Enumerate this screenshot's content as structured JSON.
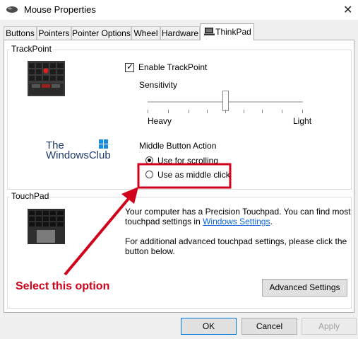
{
  "window": {
    "title": "Mouse Properties"
  },
  "tabs": [
    {
      "label": "Buttons"
    },
    {
      "label": "Pointers"
    },
    {
      "label": "Pointer Options"
    },
    {
      "label": "Wheel"
    },
    {
      "label": "Hardware"
    },
    {
      "label": "ThinkPad"
    }
  ],
  "trackpoint": {
    "group_label": "TrackPoint",
    "enable_label": "Enable TrackPoint",
    "enabled": true,
    "sensitivity_label": "Sensitivity",
    "sensitivity_level": 0.5,
    "heavy_label": "Heavy",
    "light_label": "Light",
    "middle_action_label": "Middle Button Action",
    "options": [
      {
        "label": "Use for scrolling",
        "selected": true
      },
      {
        "label": "Use as middle click",
        "selected": false
      }
    ]
  },
  "watermark": {
    "line1": "The",
    "line2": "WindowsClub"
  },
  "touchpad": {
    "group_label": "TouchPad",
    "info_line1": "Your computer has a Precision Touchpad. You can find most",
    "info_line2_prefix": "touchpad settings in ",
    "info_link": "Windows Settings",
    "info_line2_suffix": ".",
    "additional_line1": "For additional advanced touchpad settings, please click the",
    "additional_line2": "button below.",
    "advanced_button": "Advanced Settings"
  },
  "annotation": {
    "text": "Select this option"
  },
  "footer": {
    "ok": "OK",
    "cancel": "Cancel",
    "apply": "Apply"
  },
  "colors": {
    "annotation": "#d0021b",
    "link": "#0a64d8",
    "accent": "#0078d7"
  }
}
